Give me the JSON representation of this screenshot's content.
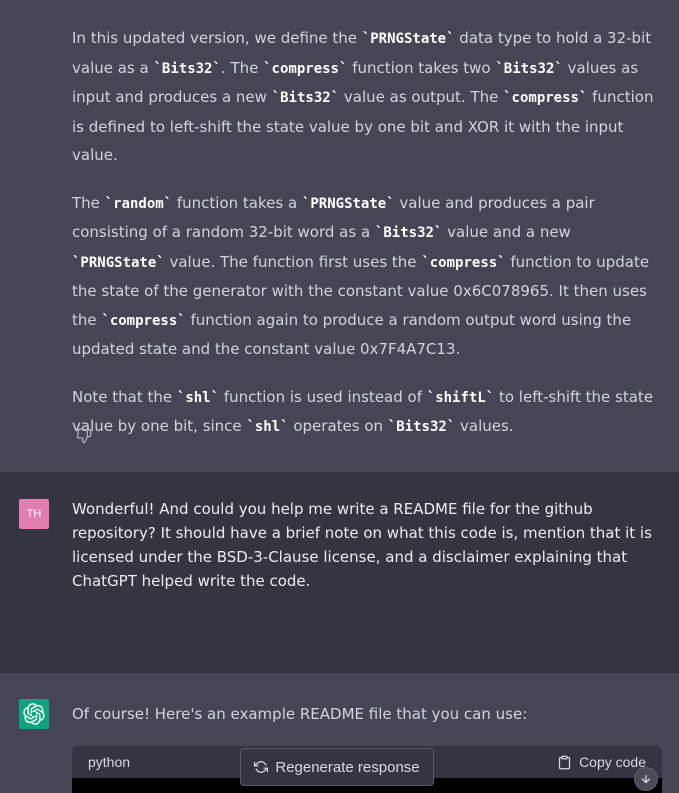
{
  "assistant_message": {
    "paragraphs": [
      [
        {
          "t": "text",
          "v": "In this updated version, we define the "
        },
        {
          "t": "code",
          "v": "`PRNGState`"
        },
        {
          "t": "text",
          "v": " data type to hold a 32-bit value as a "
        },
        {
          "t": "code",
          "v": "`Bits32`"
        },
        {
          "t": "text",
          "v": ". The "
        },
        {
          "t": "code",
          "v": "`compress`"
        },
        {
          "t": "text",
          "v": " function takes two "
        },
        {
          "t": "code",
          "v": "`Bits32`"
        },
        {
          "t": "text",
          "v": " values as input and produces a new "
        },
        {
          "t": "code",
          "v": "`Bits32`"
        },
        {
          "t": "text",
          "v": " value as output. The "
        },
        {
          "t": "code",
          "v": "`compress`"
        },
        {
          "t": "text",
          "v": " function is defined to left-shift the state value by one bit and XOR it with the input value."
        }
      ],
      [
        {
          "t": "text",
          "v": "The "
        },
        {
          "t": "code",
          "v": "`random`"
        },
        {
          "t": "text",
          "v": " function takes a "
        },
        {
          "t": "code",
          "v": "`PRNGState`"
        },
        {
          "t": "text",
          "v": " value and produces a pair consisting of a random 32-bit word as a "
        },
        {
          "t": "code",
          "v": "`Bits32`"
        },
        {
          "t": "text",
          "v": " value and a new "
        },
        {
          "t": "code",
          "v": "`PRNGState`"
        },
        {
          "t": "text",
          "v": " value. The function first uses the "
        },
        {
          "t": "code",
          "v": "`compress`"
        },
        {
          "t": "text",
          "v": " function to update the state of the generator with the constant value 0x6C078965. It then uses the "
        },
        {
          "t": "code",
          "v": "`compress`"
        },
        {
          "t": "text",
          "v": " function again to produce a random output word using the updated state and the constant value 0x7F4A7C13."
        }
      ],
      [
        {
          "t": "text",
          "v": "Note that the "
        },
        {
          "t": "code",
          "v": "`shl`"
        },
        {
          "t": "text",
          "v": " function is used instead of "
        },
        {
          "t": "code",
          "v": "`shiftL`"
        },
        {
          "t": "text",
          "v": " to left-shift the state value by one bit, since "
        },
        {
          "t": "code",
          "v": "`shl`"
        },
        {
          "t": "text",
          "v": " operates on "
        },
        {
          "t": "code",
          "v": "`Bits32`"
        },
        {
          "t": "text",
          "v": " values."
        }
      ]
    ],
    "thumbs_icon": "thumbs-down-icon"
  },
  "user_message": {
    "avatar_initials": "TH",
    "avatar_color": "#e07eb0",
    "text": "Wonderful! And could you help me write a README file for the github repository? It should have a brief note on what this code is, mention that it is licensed under the BSD-3-Clause license, and a disclaimer explaining that ChatGPT helped write the code."
  },
  "assistant_reply": {
    "avatar_color": "#10a37f",
    "text": "Of course! Here's an example README file that you can use:",
    "code_block": {
      "language": "python",
      "copy_label": "Copy code"
    }
  },
  "controls": {
    "regenerate_label": "Regenerate response",
    "scroll_icon": "arrow-down-icon"
  }
}
